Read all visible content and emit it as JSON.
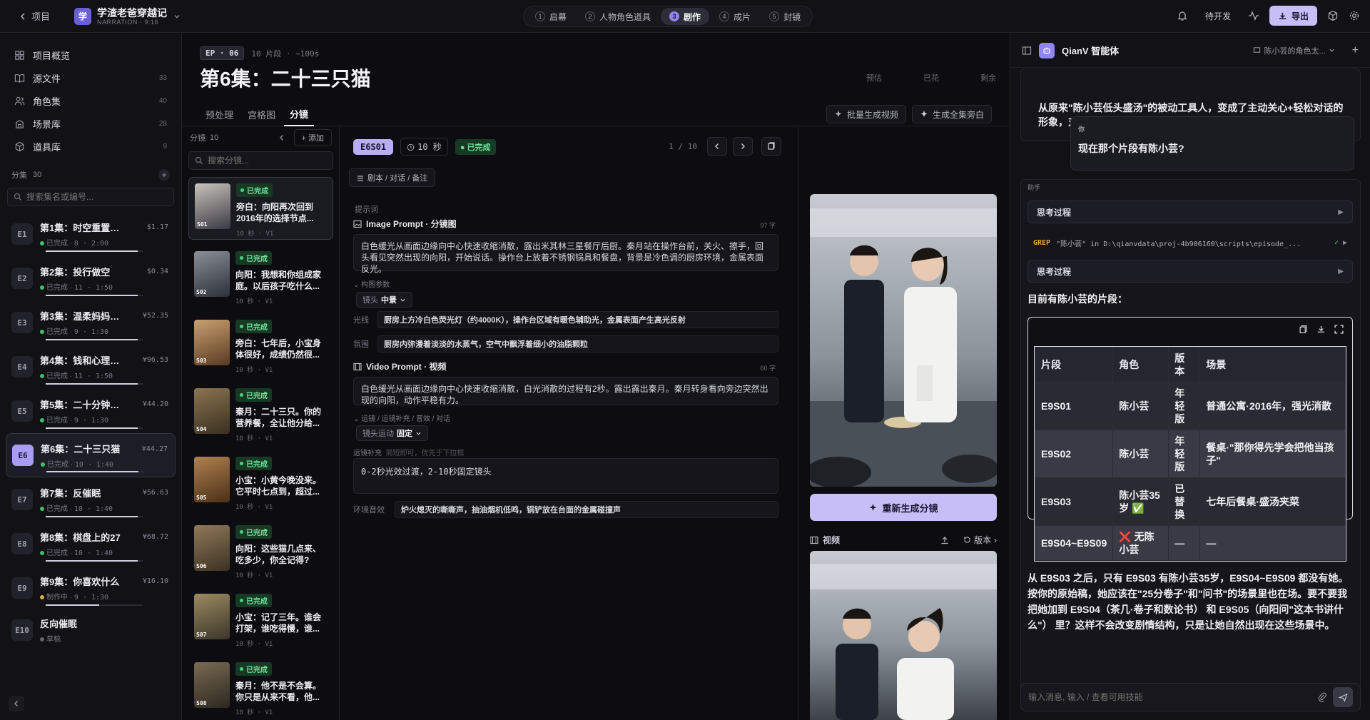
{
  "topbar": {
    "back_label": "项目",
    "project_logo": "学",
    "project_name": "学渣老爸穿越记",
    "project_sub": "NARRATION · 9:16",
    "steps": [
      {
        "n": "1",
        "label": "启幕"
      },
      {
        "n": "2",
        "label": "人物角色道具"
      },
      {
        "n": "3",
        "label": "剧作"
      },
      {
        "n": "4",
        "label": "成片"
      },
      {
        "n": "5",
        "label": "封镜"
      }
    ],
    "pending_label": "待开发",
    "export_label": "导出"
  },
  "nav": {
    "items": [
      {
        "label": "项目概览",
        "count": "",
        "icon": "grid-icon"
      },
      {
        "label": "源文件",
        "count": "33",
        "icon": "book-icon"
      },
      {
        "label": "角色集",
        "count": "40",
        "icon": "users-icon"
      },
      {
        "label": "场景库",
        "count": "28",
        "icon": "building-icon"
      },
      {
        "label": "道具库",
        "count": "9",
        "icon": "box-icon"
      }
    ],
    "episodes_label": "分集",
    "episodes_count": "30",
    "search_placeholder": "搜索集名或编号...",
    "episodes": [
      {
        "badge": "E1",
        "title": "第1集：时空重置的...",
        "status": "已完成",
        "meta": "8 · 2:00",
        "money": "$1.17",
        "state": "done",
        "progress": 0.95
      },
      {
        "badge": "E2",
        "title": "第2集：投行做空",
        "status": "已完成",
        "meta": "11 · 1:50",
        "money": "$0.34",
        "state": "done",
        "progress": 0.95
      },
      {
        "badge": "E3",
        "title": "第3集：温柔妈妈看...",
        "status": "已完成",
        "meta": "9 · 1:30",
        "money": "¥52.35",
        "state": "done",
        "progress": 0.95
      },
      {
        "badge": "E4",
        "title": "第4集：钱和心理都...",
        "status": "已完成",
        "meta": "11 · 1:50",
        "money": "¥96.53",
        "state": "done",
        "progress": 0.95
      },
      {
        "badge": "E5",
        "title": "第5集：二十分钟的...",
        "status": "已完成",
        "meta": "9 · 1:30",
        "money": "¥44.20",
        "state": "done",
        "progress": 0.95
      },
      {
        "badge": "E6",
        "title": "第6集：二十三只猫",
        "status": "已完成",
        "meta": "10 · 1:40",
        "money": "¥44.27",
        "state": "done",
        "progress": 0.95
      },
      {
        "badge": "E7",
        "title": "第7集：反催眠",
        "status": "已完成",
        "meta": "10 · 1:40",
        "money": "¥56.63",
        "state": "done",
        "progress": 0.95
      },
      {
        "badge": "E8",
        "title": "第8集：棋盘上的27",
        "status": "已完成",
        "meta": "10 · 1:40",
        "money": "¥68.72",
        "state": "done",
        "progress": 0.95
      },
      {
        "badge": "E9",
        "title": "第9集：你喜欢什么",
        "status": "制作中",
        "meta": "9 · 1:30",
        "money": "¥16.10",
        "state": "wip",
        "progress": 0.55
      },
      {
        "badge": "E10",
        "title": "反向催眠",
        "status": "草稿",
        "meta": "",
        "money": "",
        "state": "draft",
        "progress": 0
      }
    ]
  },
  "header": {
    "ep_tag": "EP · 06",
    "ep_meta": "10 片段 · ~100s",
    "title": "第6集：二十三只猫",
    "stats": [
      "预估",
      "已花",
      "剩余"
    ],
    "tabs": [
      "预处理",
      "宫格图",
      "分镜"
    ],
    "batch_video": "批量生成视频",
    "gen_all": "生成全集旁白"
  },
  "shotlist": {
    "label": "分镜",
    "count": "10",
    "add_label": "添加",
    "search_placeholder": "搜索分镜...",
    "status": "已完成",
    "shots": [
      {
        "id": "S01",
        "text": "旁白：向阳再次回到2016年的选择节点...",
        "meta": "10 秒 · V1",
        "tone": [
          "#3a3a44",
          "#c9c3bb"
        ]
      },
      {
        "id": "S02",
        "text": "向阳：我想和你组成家庭。以后孩子吃什么...",
        "meta": "10 秒 · V1",
        "tone": [
          "#2c3038",
          "#8a8e96"
        ]
      },
      {
        "id": "S03",
        "text": "旁白：七年后，小宝身体很好，成绩仍然很...",
        "meta": "10 秒 · V1",
        "tone": [
          "#5a3a22",
          "#c8a070"
        ]
      },
      {
        "id": "S04",
        "text": "秦月：二十三只。你的营养餐，全让他分给...",
        "meta": "10 秒 · V1",
        "tone": [
          "#3a3020",
          "#8a7450"
        ]
      },
      {
        "id": "S05",
        "text": "小宝：小黄今晚没来。它平时七点到，超过...",
        "meta": "10 秒 · V1",
        "tone": [
          "#4a3018",
          "#b08050"
        ]
      },
      {
        "id": "S06",
        "text": "向阳：这些猫几点来、吃多少，你全记得?",
        "meta": "10 秒 · V1",
        "tone": [
          "#3c3222",
          "#90785a"
        ]
      },
      {
        "id": "S07",
        "text": "小宝：记了三年。谁会打架，谁吃得慢，谁...",
        "meta": "10 秒 · V1",
        "tone": [
          "#3a3628",
          "#9c8a62"
        ]
      },
      {
        "id": "S08",
        "text": "秦月：他不是不会算。你只是从来不看，他...",
        "meta": "10 秒 · V1",
        "tone": [
          "#2c2820",
          "#7a6a52"
        ]
      }
    ]
  },
  "editor": {
    "shot_id": "E6S01",
    "duration": "10 秒",
    "status": "已完成",
    "pager": "1 / 10",
    "chip": "剧本 / 对话 / 备注",
    "prompt_label": "提示词",
    "image_prompt_title": "Image Prompt · 分镜图",
    "image_prompt_count": "97 字",
    "image_prompt": "白色缓光从画面边缘向中心快速收缩消散，露出米其林三星餐厅后厨。秦月站在操作台前，关火、擦手，回头看见突然出现的向阳，开始说话。操作台上放着不锈钢锅具和餐盘，背景是冷色调的厨房环境，金属表面反光。",
    "compose_label": "构图参数",
    "lens_label": "镜头",
    "lens_value": "中景",
    "light_key": "光线",
    "light_value": "厨房上方冷白色荧光灯（约4000K），操作台区域有暖色辅助光，金属表面产生高光反射",
    "mood_key": "氛围",
    "mood_value": "厨房内弥漫着淡淡的水蒸气，空气中飘浮着细小的油脂颗粒",
    "video_prompt_title": "Video Prompt · 视频",
    "video_prompt_count": "60 字",
    "video_prompt": "白色缓光从画面边缘向中心快速收缩消散，白光消散的过程有2秒。露出露出秦月。秦月转身看向旁边突然出现的向阳，动作平稳有力。",
    "motion_label": "运镜 / 运镜补充 / 音效 / 对话",
    "motion_key": "镜头运动",
    "motion_value": "固定",
    "motion_sup_label": "运镜补充",
    "motion_sup_hint": "简短即可，优先于下拉框",
    "motion_sup_value": "0-2秒光效过渡，2-10秒固定镜头",
    "sfx_key": "环境音效",
    "sfx_value": "炉火熄灭的嘶嘶声，抽油烟机低鸣，锅铲放在台面的金属碰撞声"
  },
  "preview": {
    "regen_label": "重新生成分镜",
    "video_label": "视频",
    "version_label": "版本"
  },
  "chat": {
    "title": "QianV 智能体",
    "context": "陈小芸的角色太...",
    "intro": "从原来\"陈小芸低头盛汤\"的被动工具人，变成了主动关心+轻松对话的形象，对应你原始稿里\"不逼成绩、温暖自然\"的性格。",
    "user_label": "你",
    "user_msg": "现在那个片段有陈小芸?",
    "assistant_label": "助手",
    "think_label": "思考过程",
    "grep_label": "GREP",
    "grep_text": "\"陈小芸\" in D:\\qianvdata\\proj-4b906160\\scripts\\episode_...",
    "answer_head": "目前有陈小芸的片段：",
    "table_headers": [
      "片段",
      "角色",
      "版本",
      "场景"
    ],
    "table_rows": [
      [
        "E9S01",
        "陈小芸",
        "年轻版",
        "普通公寓·2016年，强光消散"
      ],
      [
        "E9S02",
        "陈小芸",
        "年轻版",
        "餐桌·\"那你得先学会把他当孩子\""
      ],
      [
        "E9S03",
        "陈小芸35岁 ✅",
        "已替换",
        "七年后餐桌·盛汤夹菜"
      ],
      [
        "E9S04~E9S09",
        "❌ 无陈小芸",
        "—",
        "—"
      ]
    ],
    "answer_tail": "从 E9S03 之后，只有 E9S03 有陈小芸35岁，E9S04~E9S09 都没有她。按你的原始稿，她应该在\"25分卷子\"和\"问书\"的场景里也在场。要不要我把她加到 E9S04（茶几·卷子和数论书） 和 E9S05（向阳问\"这本书讲什么\"） 里？这样不会改变剧情结构，只是让她自然出现在这些场景中。",
    "input_placeholder": "输入消息, 输入 / 查看可用技能"
  }
}
